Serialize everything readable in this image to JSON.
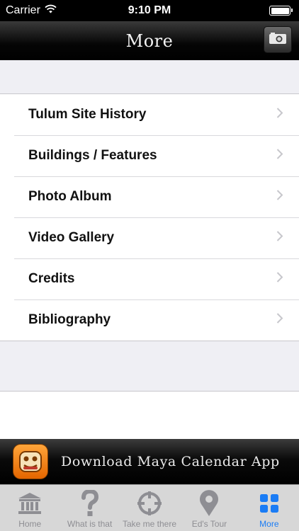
{
  "status_bar": {
    "carrier": "Carrier",
    "time": "9:10 PM",
    "battery_level": 1.0
  },
  "nav_bar": {
    "title": "More",
    "camera_icon": "camera-icon"
  },
  "menu": {
    "items": [
      {
        "label": "Tulum Site History"
      },
      {
        "label": "Buildings / Features"
      },
      {
        "label": "Photo Album"
      },
      {
        "label": "Video Gallery"
      },
      {
        "label": "Credits"
      },
      {
        "label": "Bibliography"
      }
    ]
  },
  "banner": {
    "text": "Download Maya Calendar App",
    "icon": "maya-calendar-app-icon"
  },
  "tab_bar": {
    "active_color": "#1a7cf5",
    "inactive_color": "#8e8e93",
    "tabs": [
      {
        "label": "Home",
        "icon": "temple-icon"
      },
      {
        "label": "What is that",
        "icon": "question-icon"
      },
      {
        "label": "Take me there",
        "icon": "crosshair-icon"
      },
      {
        "label": "Ed's Tour",
        "icon": "map-pin-icon"
      },
      {
        "label": "More",
        "icon": "grid-icon",
        "active": true
      }
    ]
  }
}
